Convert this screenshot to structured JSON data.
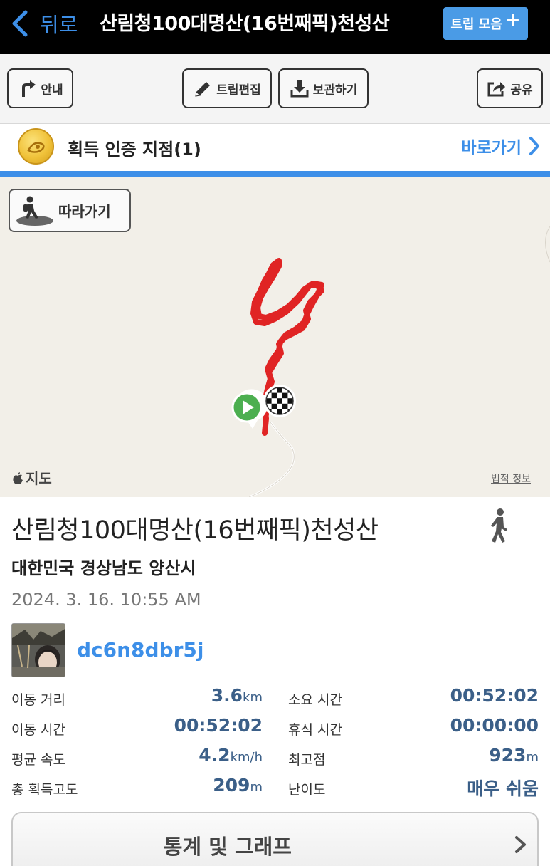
{
  "navbar": {
    "back_label": "뒤로",
    "title": "산림청100대명산(16번째픽)천성산",
    "trip_collection_label": "트립 모음",
    "trip_collection_plus": "+"
  },
  "toolbar": {
    "guide_label": "안내",
    "edit_label": "트립편집",
    "save_label": "보관하기",
    "share_label": "공유"
  },
  "certification": {
    "title": "획득 인증 지점(1)",
    "go_label": "바로가기"
  },
  "map": {
    "follow_label": "따라가기",
    "provider_label": "지도",
    "legal_label": "법적 정보"
  },
  "trip": {
    "title": "산림청100대명산(16번째픽)천성산",
    "region": "대한민국 경상남도 양산시",
    "date": "2024. 3. 16. 10:55 AM",
    "username": "dc6n8dbr5j"
  },
  "stats": {
    "distance": {
      "label": "이동 거리",
      "value": "3.6",
      "unit": "km"
    },
    "total_time": {
      "label": "소요 시간",
      "value": "00:52:02",
      "unit": ""
    },
    "moving_time": {
      "label": "이동 시간",
      "value": "00:52:02",
      "unit": ""
    },
    "rest_time": {
      "label": "휴식 시간",
      "value": "00:00:00",
      "unit": ""
    },
    "avg_speed": {
      "label": "평균 속도",
      "value": "4.2",
      "unit": "km/h"
    },
    "max_altitude": {
      "label": "최고점",
      "value": "923",
      "unit": "m"
    },
    "total_ascent": {
      "label": "총 획득고도",
      "value": "209",
      "unit": "m"
    },
    "difficulty": {
      "label": "난이도",
      "value": "매우 쉬움",
      "unit": ""
    }
  },
  "graph_button": {
    "label": "통계 및 그래프"
  },
  "colors": {
    "accent_blue": "#3d8fe8",
    "track_red": "#e02424",
    "stat_value": "#3b5f88",
    "start_marker": "#4caf50"
  },
  "icons": [
    "chevron-left-icon",
    "plus-icon",
    "turn-right-icon",
    "pencil-icon",
    "download-icon",
    "share-icon",
    "medal-icon",
    "chevron-right-icon",
    "hiker-icon",
    "apple-icon",
    "play-icon",
    "checkered-flag-icon",
    "walking-person-icon"
  ]
}
